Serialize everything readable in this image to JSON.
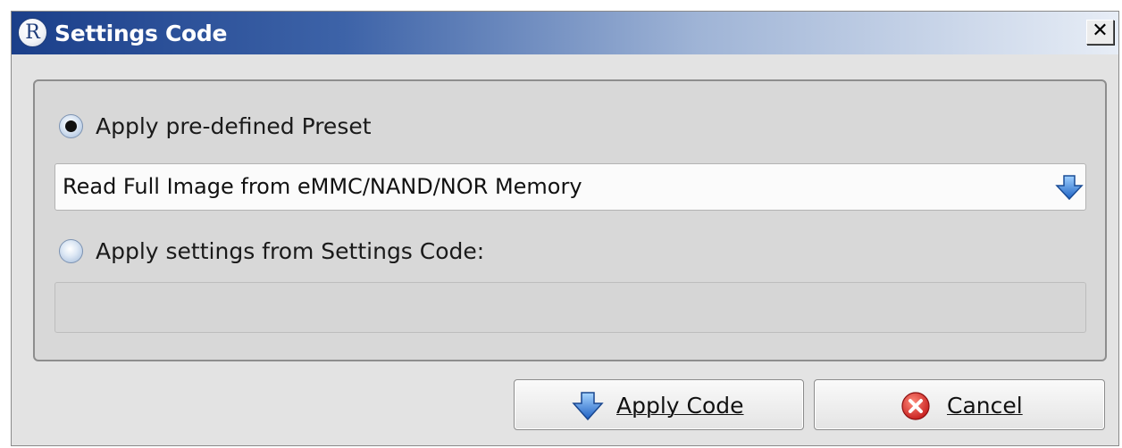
{
  "window": {
    "title": "Settings Code",
    "logo_letter": "R",
    "close_glyph": "✕"
  },
  "options": {
    "preset": {
      "label": "Apply pre-defined Preset",
      "checked": true,
      "selected_value": "Read Full Image from eMMC/NAND/NOR Memory"
    },
    "settings_code": {
      "label": "Apply settings from Settings Code:",
      "checked": false,
      "value": ""
    }
  },
  "buttons": {
    "apply": {
      "label": "Apply Code",
      "icon": "blue-down-arrow-icon"
    },
    "cancel": {
      "label": "Cancel",
      "icon": "red-x-circle-icon"
    }
  },
  "colors": {
    "title_gradient_start": "#1b3f8a",
    "title_gradient_end": "#e7edf6",
    "accent_blue": "#2f6fd0",
    "cancel_red": "#d32a2a"
  }
}
